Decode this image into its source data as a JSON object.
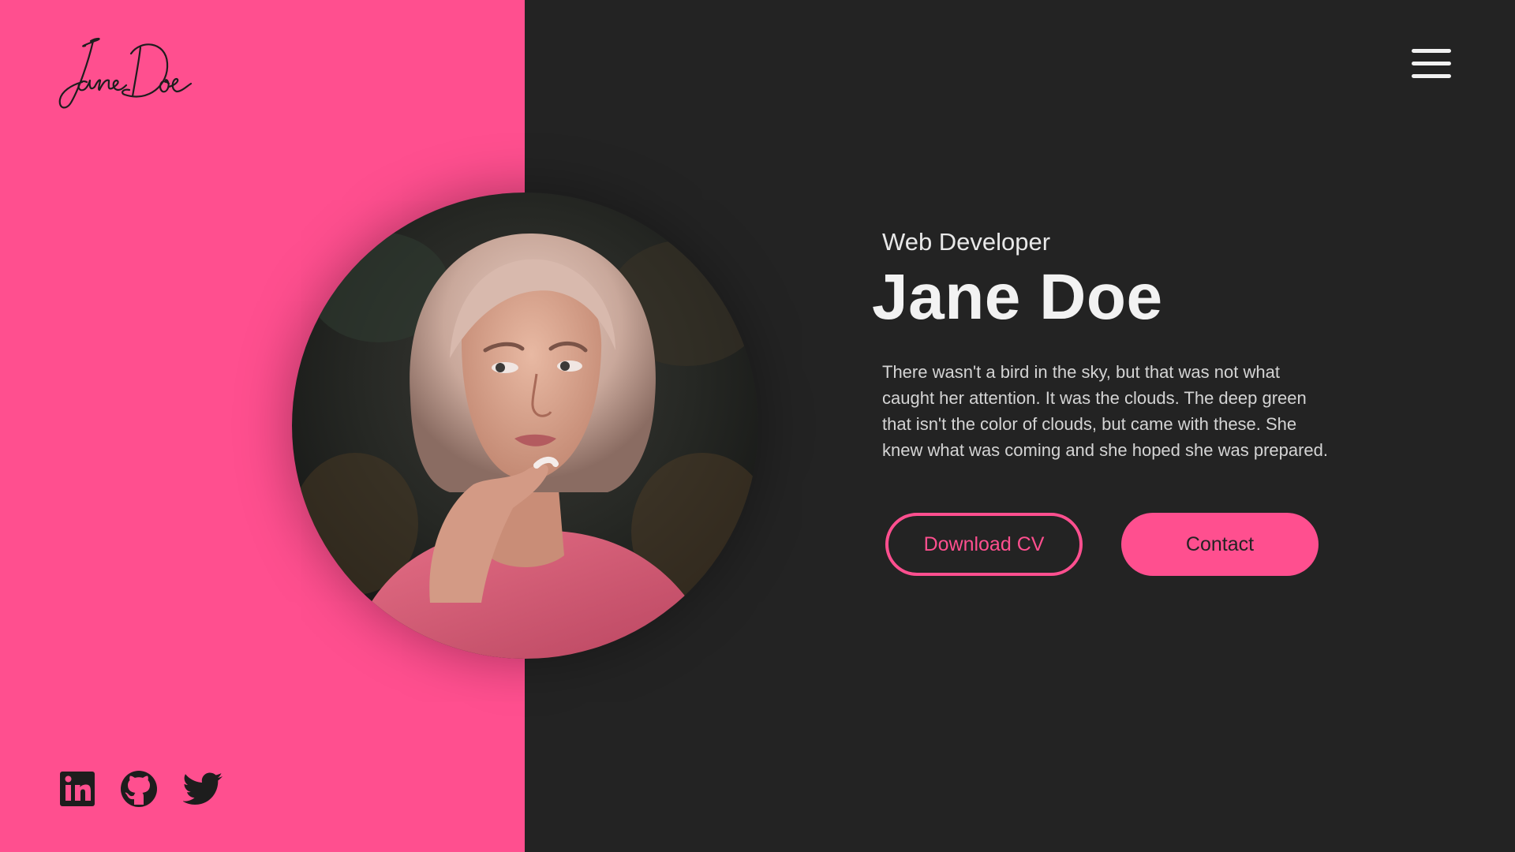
{
  "brand": {
    "logo_text": "Jane Doe"
  },
  "nav": {
    "menu_icon": "hamburger-menu-icon"
  },
  "hero": {
    "role": "Web Developer",
    "name": "Jane Doe",
    "bio": "There wasn't a bird in the sky, but that was not what caught her attention. It was the clouds. The deep green that isn't the color of clouds, but came with these. She knew what was coming and she hoped she was prepared.",
    "download_label": "Download CV",
    "contact_label": "Contact"
  },
  "social": [
    {
      "icon": "linkedin-icon"
    },
    {
      "icon": "github-icon"
    },
    {
      "icon": "twitter-icon"
    }
  ],
  "colors": {
    "accent": "#ff4f8f",
    "background": "#232323",
    "text": "#f2f2f2"
  }
}
